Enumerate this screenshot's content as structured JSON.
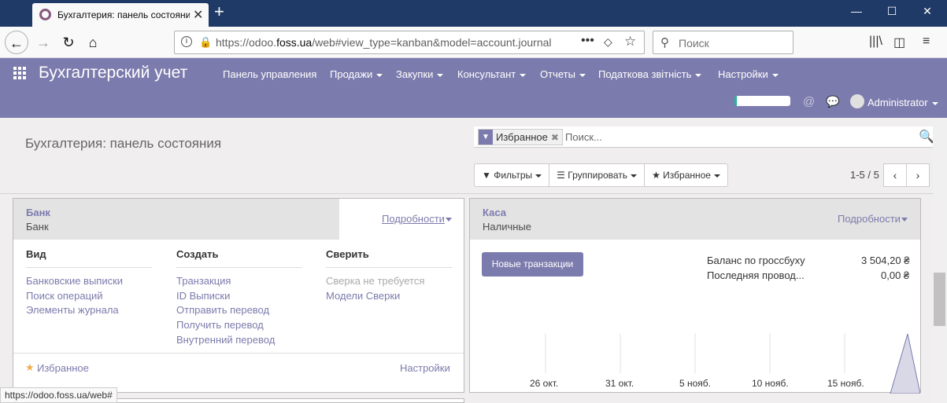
{
  "browser": {
    "tab_title": "Бухгалтерия: панель состояния",
    "url_prefix": "https://odoo.",
    "url_domain": "foss.ua",
    "url_rest": "/web#view_type=kanban&model=account.journal",
    "search_placeholder": "Поиск"
  },
  "odoo": {
    "brand": "Бухгалтерский учет",
    "menu": [
      "Панель управления",
      "Продажи",
      "Закупки",
      "Консультант",
      "Отчеты",
      "Податкова звітність",
      "Настройки"
    ],
    "user": "Administrator"
  },
  "control_panel": {
    "breadcrumb": "Бухгалтерия: панель состояния",
    "facet": "Избранное",
    "search_placeholder": "Поиск...",
    "filters": "Фильтры",
    "group_by": "Группировать",
    "favorites": "Избранное",
    "pager": "1-5 / 5"
  },
  "bank_card": {
    "title": "Банк",
    "subtitle": "Банк",
    "more": "Подробности",
    "col_view": "Вид",
    "col_create": "Создать",
    "col_reconcile": "Сверить",
    "view_links": [
      "Банковские выписки",
      "Поиск операций",
      "Элементы журнала"
    ],
    "create_links": [
      "Транзакция",
      "ID Выписки",
      "Отправить перевод",
      "Получить перевод",
      "Внутренний перевод"
    ],
    "reconcile_muted": "Сверка не требуется",
    "reconcile_link": "Модели Сверки",
    "favorite": "Избранное",
    "settings": "Настройки"
  },
  "cash_card": {
    "title": "Каса",
    "subtitle": "Наличные",
    "more": "Подробности",
    "new_tx": "Новые транзакции",
    "balance_label": "Баланс по гроссбуху",
    "balance_value": "3 504,20 ₴",
    "last_label": "Последняя провод...",
    "last_value": "0,00 ₴"
  },
  "chart_data": {
    "type": "area",
    "x": [
      "26 окт.",
      "31 окт.",
      "5 нояб.",
      "10 нояб.",
      "15 нояб."
    ],
    "note": "",
    "series": [
      {
        "values": [
          0,
          0,
          0,
          0,
          0
        ]
      }
    ]
  },
  "status_url": "https://odoo.foss.ua/web#",
  "colors": {
    "brand": "#7c7bad",
    "accent": "#21b799"
  }
}
